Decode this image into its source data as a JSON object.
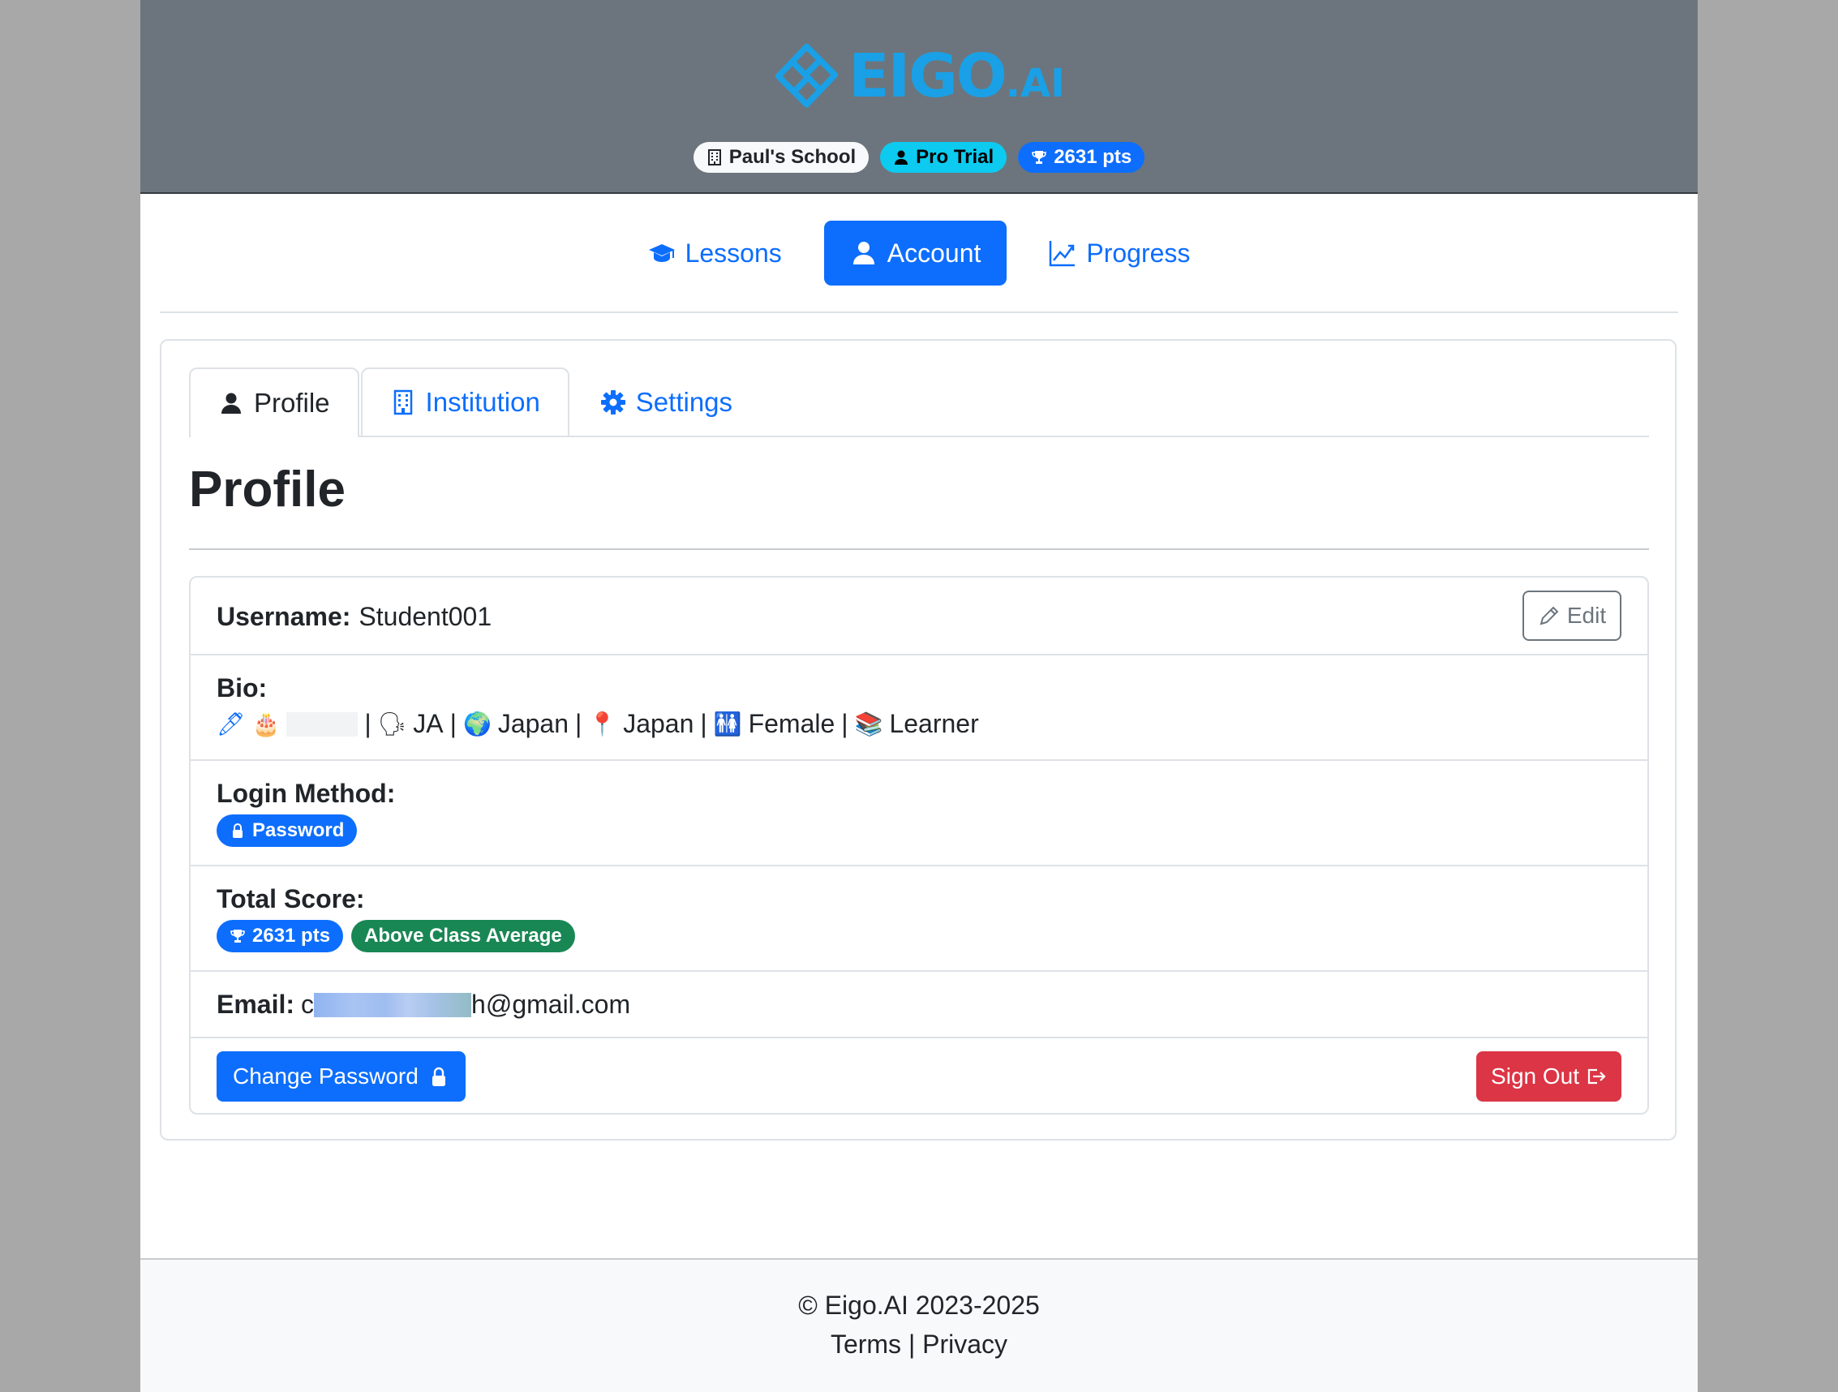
{
  "brand": {
    "name_main": "EIGO",
    "name_suffix": ".AI",
    "color": "#1aa0e6"
  },
  "header_badges": {
    "school": "Paul's School",
    "plan": "Pro Trial",
    "points": "2631 pts"
  },
  "nav": {
    "lessons": "Lessons",
    "account": "Account",
    "progress": "Progress"
  },
  "tabs": {
    "profile": "Profile",
    "institution": "Institution",
    "settings": "Settings"
  },
  "page_title": "Profile",
  "profile": {
    "username_label": "Username:",
    "username_value": "Student001",
    "edit_label": "Edit",
    "bio_label": "Bio:",
    "bio": {
      "pencil": "🖊",
      "cake": "🎂",
      "sep": "|",
      "lang_icon": "🗣",
      "language": "JA",
      "globe": "🌍",
      "country": "Japan",
      "pin": "📍",
      "location": "Japan",
      "gender_icon": "🚻",
      "gender": "Female",
      "books": "📚",
      "role": "Learner"
    },
    "login_label": "Login Method:",
    "login_method": "Password",
    "score_label": "Total Score:",
    "score": "2631 pts",
    "score_status": "Above Class Average",
    "email_label": "Email:",
    "email_start": "c",
    "email_end": "h@gmail.com"
  },
  "actions": {
    "change_password": "Change Password",
    "sign_out": "Sign Out"
  },
  "footer": {
    "copyright": "© Eigo.AI 2023-2025",
    "terms": "Terms",
    "privacy": "Privacy",
    "sep": "|"
  },
  "colors": {
    "primary": "#0d6efd",
    "danger": "#dc3545",
    "success": "#198754",
    "info": "#0dcaf0",
    "header_bg": "#6c757d"
  }
}
